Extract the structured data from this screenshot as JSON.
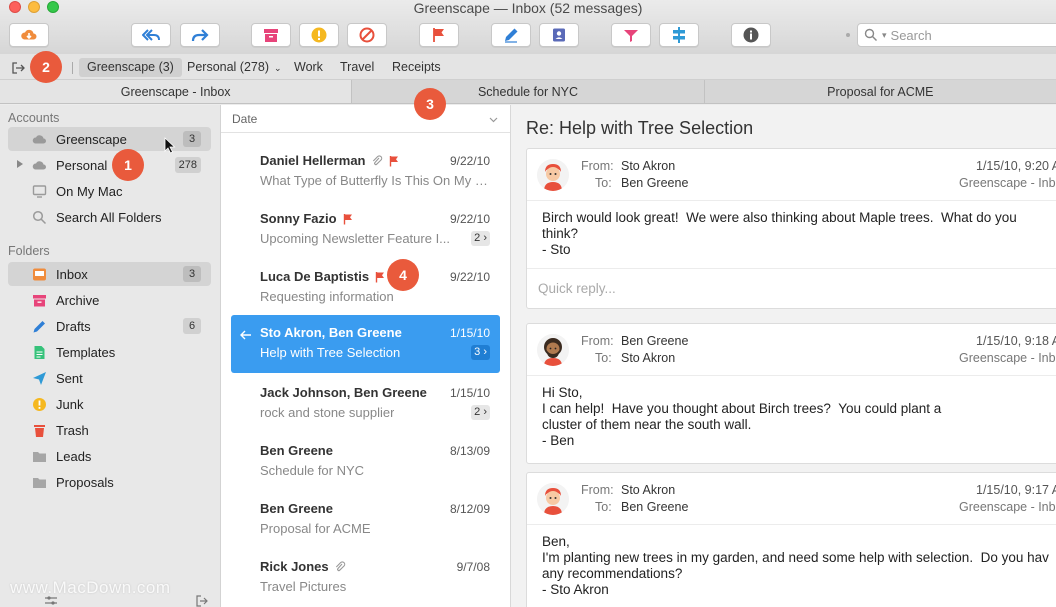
{
  "window": {
    "title": "Greenscape — Inbox (52 messages)"
  },
  "toolbar": {
    "search_placeholder": "Search",
    "buttons": [
      {
        "icon": "cloud-download-icon",
        "color": "#f08c3c"
      },
      {
        "icon": "reply-all-icon",
        "color": "#2f7fd6"
      },
      {
        "icon": "forward-icon",
        "color": "#2f7fd6"
      },
      {
        "icon": "archive-icon",
        "color": "#e7447a"
      },
      {
        "icon": "junk-icon",
        "color": "#f5b820"
      },
      {
        "icon": "block-icon",
        "color": "#e8503c"
      },
      {
        "icon": "flag-icon",
        "color": "#e8503c"
      },
      {
        "icon": "compose-icon",
        "color": "#2f7fd6"
      },
      {
        "icon": "contacts-icon",
        "color": "#5a6ab8"
      },
      {
        "icon": "tag-icon",
        "color": "#e7447a"
      },
      {
        "icon": "rules-icon",
        "color": "#2f9ad6"
      },
      {
        "icon": "info-icon",
        "color": "#555555"
      }
    ]
  },
  "filterbar": {
    "items": [
      "Greenscape (3)",
      "Personal (278)",
      "Work",
      "Travel",
      "Receipts"
    ]
  },
  "tabs": [
    "Greenscape - Inbox",
    "Schedule for NYC",
    "Proposal for ACME"
  ],
  "sidebar": {
    "accounts_heading": "Accounts",
    "folders_heading": "Folders",
    "accounts": [
      {
        "label": "Greenscape",
        "badge": "3"
      },
      {
        "label": "Personal",
        "badge": "278"
      },
      {
        "label": "On My Mac",
        "badge": ""
      },
      {
        "label": "Search All Folders",
        "badge": ""
      }
    ],
    "folders": [
      {
        "label": "Inbox",
        "badge": "3"
      },
      {
        "label": "Archive",
        "badge": ""
      },
      {
        "label": "Drafts",
        "badge": "6"
      },
      {
        "label": "Templates",
        "badge": ""
      },
      {
        "label": "Sent",
        "badge": ""
      },
      {
        "label": "Junk",
        "badge": ""
      },
      {
        "label": "Trash",
        "badge": ""
      },
      {
        "label": "Leads",
        "badge": ""
      },
      {
        "label": "Proposals",
        "badge": ""
      }
    ]
  },
  "message_list": {
    "sort_label": "Date",
    "messages": [
      {
        "from": "Daniel Hellerman",
        "subject": "What Type of Butterfly Is This On My F...",
        "date": "9/22/10",
        "count": "",
        "attachment": true,
        "flagged": true
      },
      {
        "from": "Sonny Fazio",
        "subject": "Upcoming Newsletter Feature I...",
        "date": "9/22/10",
        "count": "2",
        "attachment": false,
        "flagged": true
      },
      {
        "from": "Luca De Baptistis",
        "subject": "Requesting information",
        "date": "9/22/10",
        "count": "",
        "attachment": false,
        "flagged": true
      },
      {
        "from": "Sto Akron, Ben Greene",
        "subject": "Help with Tree Selection",
        "date": "1/15/10",
        "count": "3",
        "attachment": false,
        "flagged": false
      },
      {
        "from": "Jack Johnson, Ben Greene",
        "subject": "rock and stone supplier",
        "date": "1/15/10",
        "count": "2",
        "attachment": false,
        "flagged": false
      },
      {
        "from": "Ben Greene",
        "subject": "Schedule for NYC",
        "date": "8/13/09",
        "count": "",
        "attachment": false,
        "flagged": false
      },
      {
        "from": "Ben Greene",
        "subject": "Proposal for ACME",
        "date": "8/12/09",
        "count": "",
        "attachment": false,
        "flagged": false
      },
      {
        "from": "Rick Jones",
        "subject": "Travel Pictures",
        "date": "9/7/08",
        "count": "",
        "attachment": true,
        "flagged": false
      }
    ]
  },
  "reader": {
    "subject": "Re: Help with Tree Selection",
    "from_label": "From:",
    "to_label": "To:",
    "quick_reply_placeholder": "Quick reply...",
    "messages": [
      {
        "from": "Sto Akron",
        "to": "Ben Greene",
        "date": "1/15/10, 9:20 A",
        "account": "Greenscape - Inb",
        "body": "Birch would look great!  We were also thinking about Maple trees.  What do you\nthink?\n- Sto"
      },
      {
        "from": "Ben Greene",
        "to": "Sto Akron",
        "date": "1/15/10, 9:18 A",
        "account": "Greenscape - Inb",
        "body": "Hi Sto,\nI can help!  Have you thought about Birch trees?  You could plant a\ncluster of them near the south wall.\n- Ben"
      },
      {
        "from": "Sto Akron",
        "to": "Ben Greene",
        "date": "1/15/10, 9:17 A",
        "account": "Greenscape - Inb",
        "body": "Ben,\nI'm planting new trees in my garden, and need some help with selection.  Do you hav\nany recommendations?\n- Sto Akron"
      }
    ]
  },
  "callouts": [
    "1",
    "2",
    "3",
    "4"
  ],
  "watermark": "www.MacDown.com",
  "colors": {
    "accent": "#3a9cf0",
    "callout": "#e95a3c"
  }
}
